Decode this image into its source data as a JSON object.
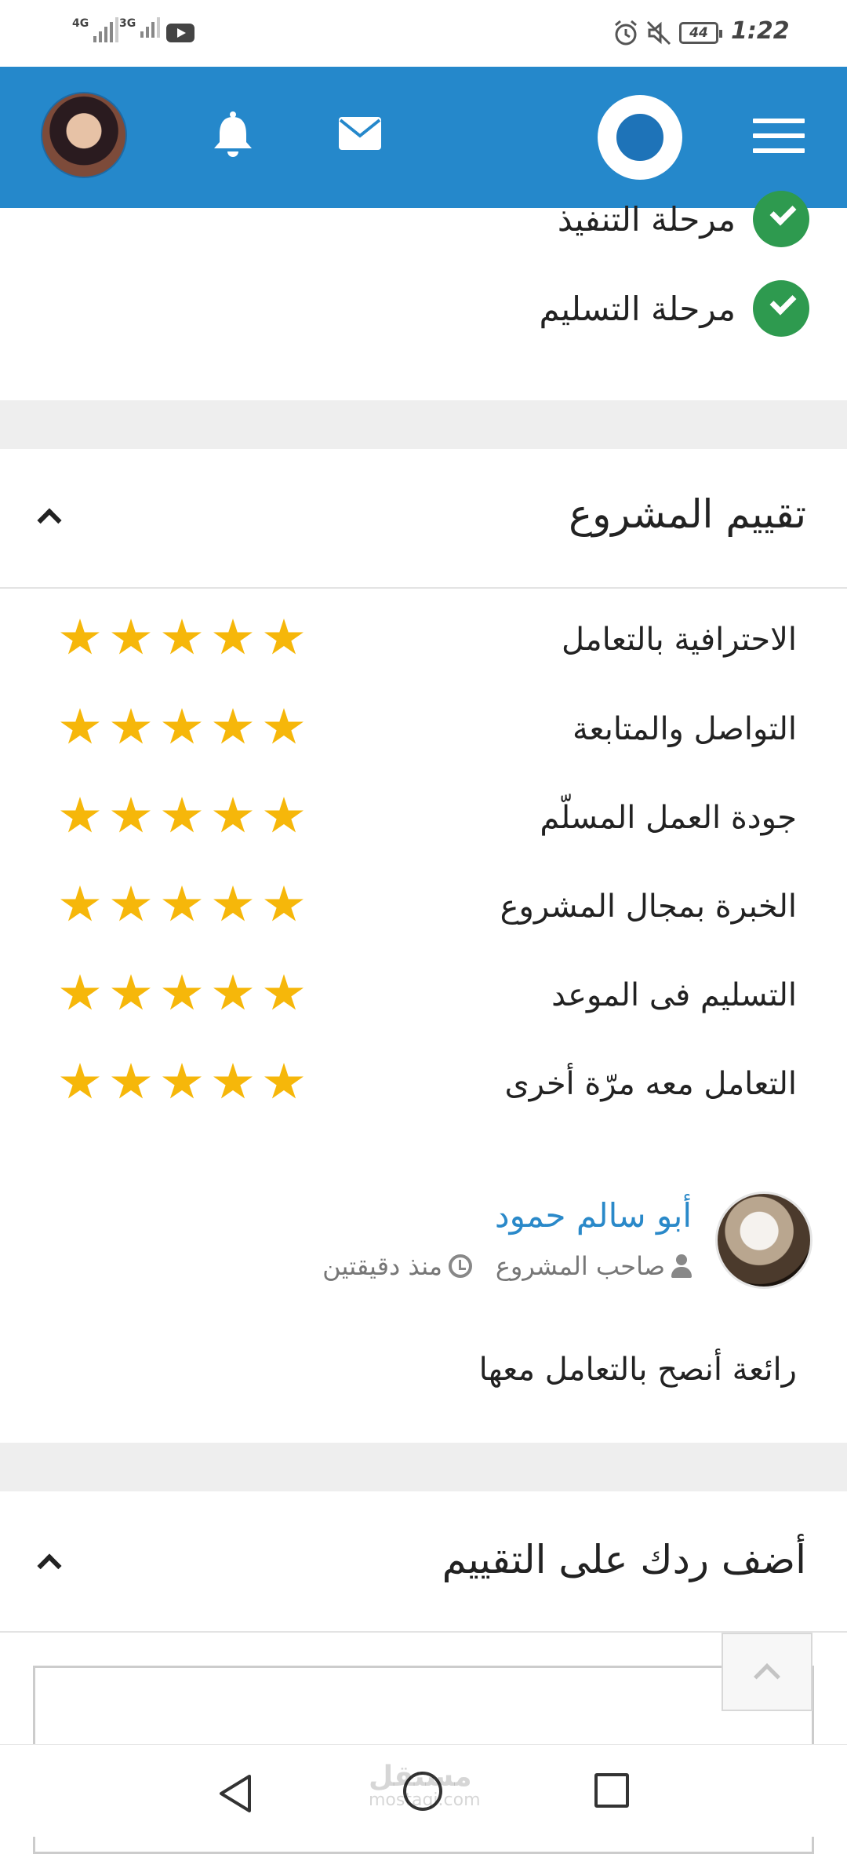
{
  "status_bar": {
    "time": "1:22",
    "battery": "44",
    "network_1": "4G",
    "network_2": "3G"
  },
  "header": {
    "icons": [
      "menu-icon",
      "logo-icon",
      "mail-icon",
      "bell-icon",
      "user-avatar"
    ],
    "brand_color": "#2588cb"
  },
  "phases": [
    {
      "label": "مرحلة التنفيذ",
      "status": "done"
    },
    {
      "label": "مرحلة التسليم",
      "status": "done"
    }
  ],
  "rating_section": {
    "title": "تقييم المشروع",
    "criteria": [
      {
        "label": "الاحترافية بالتعامل",
        "stars": 5
      },
      {
        "label": "التواصل والمتابعة",
        "stars": 5
      },
      {
        "label": "جودة العمل المسلّم",
        "stars": 5
      },
      {
        "label": "الخبرة بمجال المشروع",
        "stars": 5
      },
      {
        "label": "التسليم فى الموعد",
        "stars": 5
      },
      {
        "label": "التعامل معه مرّة أخرى",
        "stars": 5
      }
    ]
  },
  "review": {
    "reviewer_name": "أبو سالم حمود",
    "reviewer_role": "صاحب المشروع",
    "time_ago": "منذ دقيقتين",
    "text": "رائعة أنصح بالتعامل معها"
  },
  "reply_section": {
    "title": "أضف ردك على التقييم"
  },
  "watermark": {
    "text": "مستقل",
    "sub": "mostaqi.com"
  },
  "colors": {
    "star": "#f6b70a",
    "check": "#2e9a4f",
    "link": "#2a89c9"
  }
}
